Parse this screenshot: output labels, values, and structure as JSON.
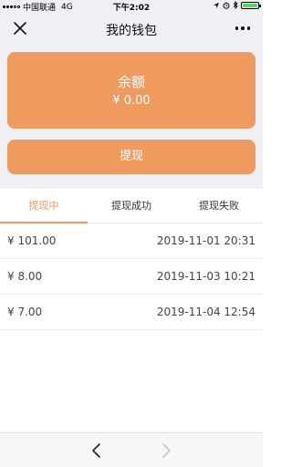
{
  "status": {
    "carrier": "中国联通",
    "network": "4G",
    "time": "下午2:02"
  },
  "nav": {
    "title": "我的钱包"
  },
  "balance": {
    "label": "余额",
    "value": "¥ 0.00"
  },
  "withdraw_button": "提现",
  "tabs": [
    {
      "label": "提现中",
      "active": true
    },
    {
      "label": "提现成功",
      "active": false
    },
    {
      "label": "提现失败",
      "active": false
    }
  ],
  "records": [
    {
      "amount": "¥ 101.00",
      "time": "2019-11-01 20:31"
    },
    {
      "amount": "¥ 8.00",
      "time": "2019-11-03 10:21"
    },
    {
      "amount": "¥ 7.00",
      "time": "2019-11-04 12:54"
    }
  ],
  "colors": {
    "accent": "#ef9a5f",
    "background": "#efeff4",
    "battery": "#4cd964"
  },
  "icons": {
    "close": "close-icon",
    "more": "more-icon",
    "back": "chevron-left-icon",
    "forward": "chevron-right-icon"
  }
}
